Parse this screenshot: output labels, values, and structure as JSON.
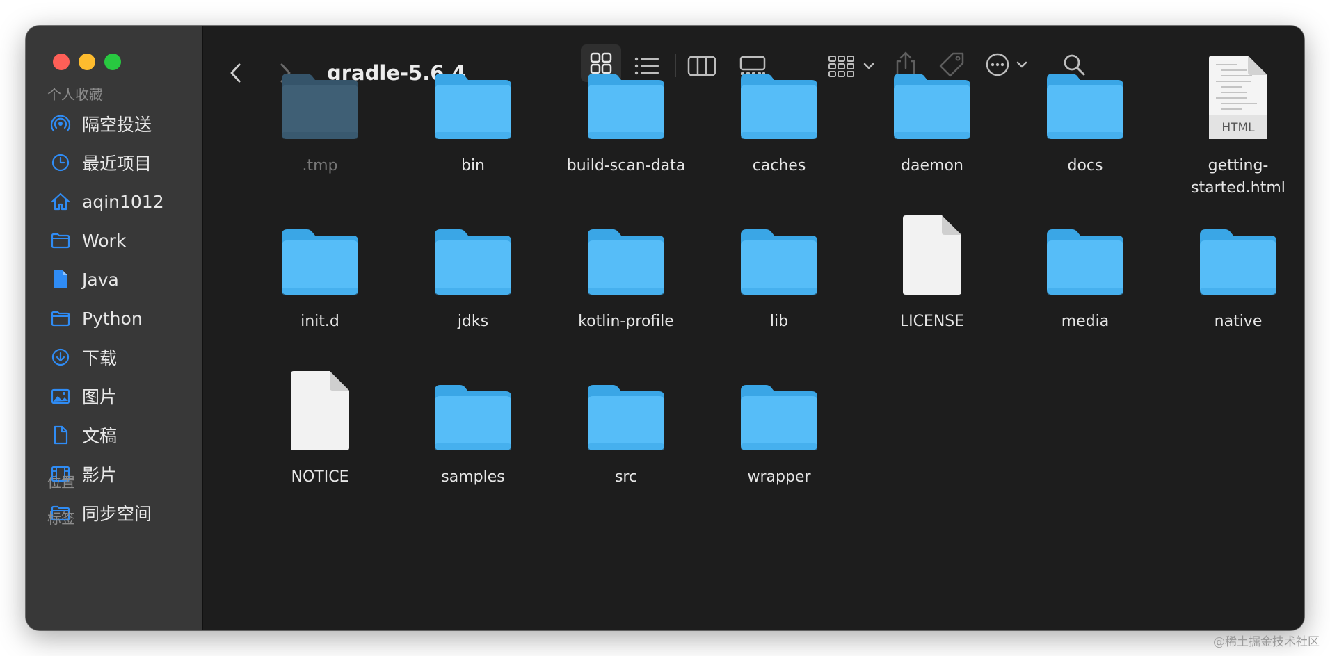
{
  "window": {
    "title": "gradle-5.6.4"
  },
  "sidebar": {
    "favorites_heading": "个人收藏",
    "items": [
      {
        "label": "隔空投送",
        "icon": "airdrop-icon"
      },
      {
        "label": "最近项目",
        "icon": "clock-icon"
      },
      {
        "label": "aqin1012",
        "icon": "home-icon"
      },
      {
        "label": "Work",
        "icon": "folder-icon"
      },
      {
        "label": "Java",
        "icon": "document-icon"
      },
      {
        "label": "Python",
        "icon": "folder-icon"
      },
      {
        "label": "下载",
        "icon": "download-icon"
      },
      {
        "label": "图片",
        "icon": "photo-icon"
      },
      {
        "label": "文稿",
        "icon": "document-outline-icon"
      },
      {
        "label": "影片",
        "icon": "film-icon"
      },
      {
        "label": "同步空间",
        "icon": "folder-icon"
      }
    ],
    "locations_heading": "位置",
    "tags_heading": "标签"
  },
  "toolbar": {
    "back_icon": "chevron-left-icon",
    "forward_icon": "chevron-right-icon",
    "views": [
      "icon-view-icon",
      "list-view-icon",
      "column-view-icon",
      "gallery-view-icon"
    ],
    "active_view": "icon-view-icon"
  },
  "files": [
    {
      "name": ".tmp",
      "kind": "folder",
      "dim": true
    },
    {
      "name": "bin",
      "kind": "folder"
    },
    {
      "name": "build-scan-data",
      "kind": "folder"
    },
    {
      "name": "caches",
      "kind": "folder"
    },
    {
      "name": "daemon",
      "kind": "folder"
    },
    {
      "name": "docs",
      "kind": "folder"
    },
    {
      "name": "getting-\nstarted.html",
      "kind": "html",
      "badge": "HTML"
    },
    {
      "name": "init.d",
      "kind": "folder"
    },
    {
      "name": "jdks",
      "kind": "folder"
    },
    {
      "name": "kotlin-profile",
      "kind": "folder"
    },
    {
      "name": "lib",
      "kind": "folder"
    },
    {
      "name": "LICENSE",
      "kind": "file"
    },
    {
      "name": "media",
      "kind": "folder"
    },
    {
      "name": "native",
      "kind": "folder"
    },
    {
      "name": "NOTICE",
      "kind": "file"
    },
    {
      "name": "samples",
      "kind": "folder"
    },
    {
      "name": "src",
      "kind": "folder"
    },
    {
      "name": "wrapper",
      "kind": "folder"
    }
  ],
  "colors": {
    "folder": "#56bdf8",
    "folder_dark": "#3aa6e6",
    "sidebar_icon": "#2f8cf5"
  },
  "watermark": "@稀土掘金技术社区"
}
